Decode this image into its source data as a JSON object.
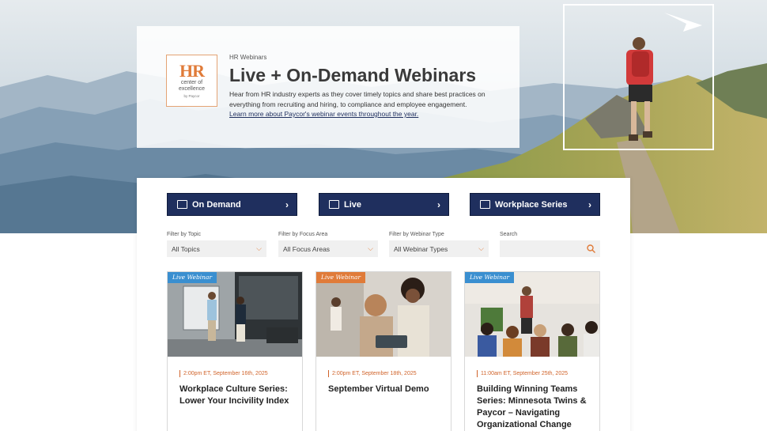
{
  "hero": {
    "eyebrow": "HR Webinars",
    "title": "Live + On-Demand Webinars",
    "description": "Hear from HR industry experts as they cover timely topics and share best practices on everything from recruiting and hiring, to compliance and employee engagement.",
    "link": "Learn more about Paycor's webinar events throughout the year."
  },
  "logo": {
    "mark": "HR",
    "line1": "center of",
    "line2": "excellence",
    "byline": "by Paycor"
  },
  "nav": {
    "buttons": [
      {
        "label": "On Demand",
        "icon": "video-icon"
      },
      {
        "label": "Live",
        "icon": "play-icon"
      },
      {
        "label": "Workplace Series",
        "icon": "calendar-icon"
      }
    ]
  },
  "filters": {
    "topic": {
      "label": "Filter by Topic",
      "value": "All Topics"
    },
    "focus": {
      "label": "Filter by Focus Area",
      "value": "All Focus Areas"
    },
    "type": {
      "label": "Filter by Webinar Type",
      "value": "All Webinar Types"
    },
    "search": {
      "label": "Search",
      "placeholder": ""
    }
  },
  "cards": [
    {
      "badge": "Live Webinar",
      "date": "2:00pm ET, September 16th, 2025",
      "title": "Workplace Culture Series: Lower Your Incivility Index",
      "badge_color": "#3a8fd0"
    },
    {
      "badge": "Live Webinar",
      "date": "2:00pm ET, September 18th, 2025",
      "title": "September Virtual Demo",
      "badge_color": "#e07b39"
    },
    {
      "badge": "Live Webinar",
      "date": "11:00am ET, September 25th, 2025",
      "title": "Building Winning Teams Series: Minnesota Twins & Paycor – Navigating Organizational Change",
      "badge_color": "#3a8fd0"
    }
  ],
  "colors": {
    "navy": "#1f2f5e",
    "accent_orange": "#e07b39",
    "badge_blue": "#3a8fd0"
  }
}
